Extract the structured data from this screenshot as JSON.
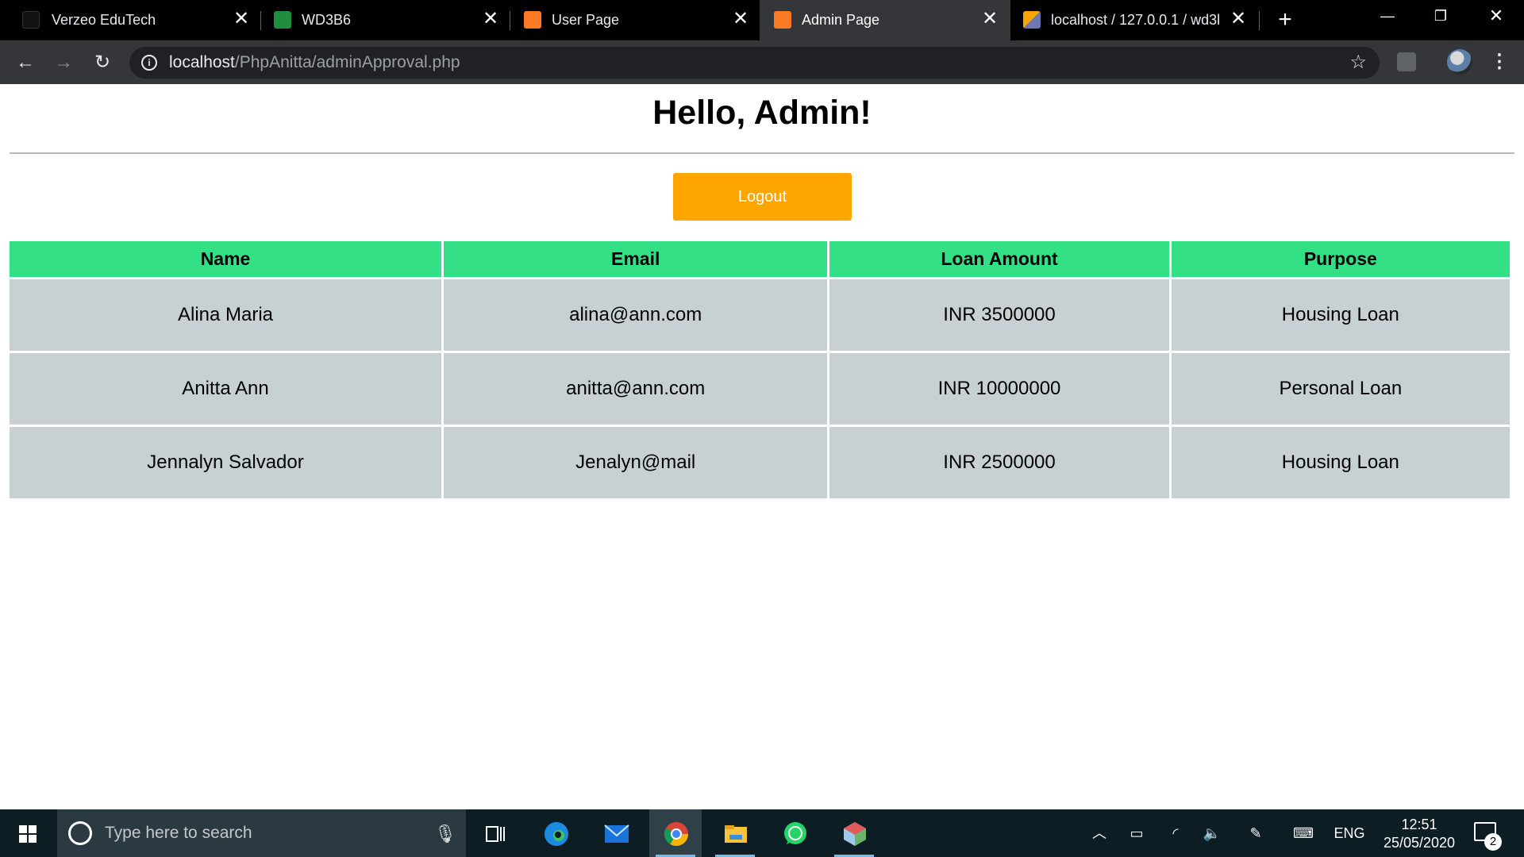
{
  "browser": {
    "tabs": [
      {
        "title": "Verzeo EduTech",
        "active": false
      },
      {
        "title": "WD3B6",
        "active": false
      },
      {
        "title": "User Page",
        "active": false
      },
      {
        "title": "Admin Page",
        "active": true
      },
      {
        "title": "localhost / 127.0.0.1 / wd3b",
        "active": false
      }
    ],
    "url_host": "localhost",
    "url_path": "/PhpAnitta/adminApproval.php"
  },
  "page": {
    "heading": "Hello, Admin!",
    "logout_label": "Logout",
    "table": {
      "headers": [
        "Name",
        "Email",
        "Loan Amount",
        "Purpose"
      ],
      "rows": [
        [
          "Alina Maria",
          "alina@ann.com",
          "INR 3500000",
          "Housing Loan"
        ],
        [
          "Anitta Ann",
          "anitta@ann.com",
          "INR 10000000",
          "Personal Loan"
        ],
        [
          "Jennalyn Salvador",
          "Jenalyn@mail",
          "INR 2500000",
          "Housing Loan"
        ]
      ]
    }
  },
  "taskbar": {
    "search_placeholder": "Type here to search",
    "language": "ENG",
    "time": "12:51",
    "date": "25/05/2020",
    "notification_count": "2"
  },
  "colors": {
    "header_bg": "#34e085",
    "row_bg": "#c7d0d2",
    "logout_bg": "#ffa500"
  }
}
